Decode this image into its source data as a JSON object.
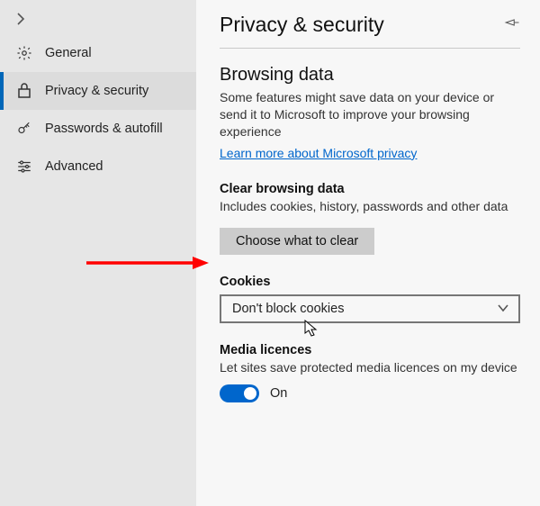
{
  "sidebar": {
    "items": [
      {
        "label": "General"
      },
      {
        "label": "Privacy & security"
      },
      {
        "label": "Passwords & autofill"
      },
      {
        "label": "Advanced"
      }
    ]
  },
  "header": {
    "title": "Privacy & security"
  },
  "browsing": {
    "title": "Browsing data",
    "desc": "Some features might save data on your device or send it to Microsoft to improve your browsing experience",
    "link": "Learn more about Microsoft privacy"
  },
  "clear": {
    "title": "Clear browsing data",
    "desc": "Includes cookies, history, passwords and other data",
    "button": "Choose what to clear"
  },
  "cookies": {
    "title": "Cookies",
    "selected": "Don't block cookies"
  },
  "media": {
    "title": "Media licences",
    "desc": "Let sites save protected media licences on my device",
    "state": "On"
  }
}
